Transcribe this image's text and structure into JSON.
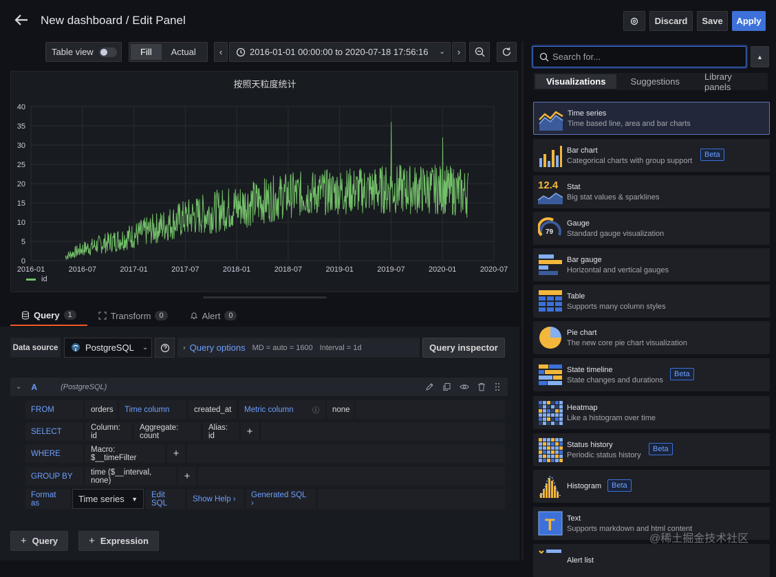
{
  "header": {
    "title": "New dashboard / Edit Panel",
    "discard": "Discard",
    "save": "Save",
    "apply": "Apply"
  },
  "toolbar": {
    "table_view": "Table view",
    "fill": "Fill",
    "actual": "Actual",
    "time_range": "2016-01-01 00:00:00 to 2020-07-18 17:56:16"
  },
  "panel": {
    "title": "按照天粒度统计"
  },
  "chart_data": {
    "type": "line",
    "x_ticks": [
      "2016-01",
      "2016-07",
      "2017-01",
      "2017-07",
      "2018-01",
      "2018-07",
      "2019-01",
      "2019-07",
      "2020-01",
      "2020-07"
    ],
    "y_ticks": [
      "0",
      "5",
      "10",
      "15",
      "20",
      "25",
      "30",
      "35",
      "40"
    ],
    "ylim": [
      0,
      40
    ],
    "series": [
      {
        "name": "id",
        "color": "#73bf69"
      }
    ],
    "trend": [
      {
        "x": "2016-05",
        "low": 0,
        "high": 2
      },
      {
        "x": "2016-07",
        "low": 1,
        "high": 5
      },
      {
        "x": "2017-01",
        "low": 3,
        "high": 10
      },
      {
        "x": "2017-07",
        "low": 6,
        "high": 16
      },
      {
        "x": "2018-01",
        "low": 8,
        "high": 20
      },
      {
        "x": "2018-07",
        "low": 11,
        "high": 23
      },
      {
        "x": "2019-01",
        "low": 12,
        "high": 24
      },
      {
        "x": "2019-07",
        "low": 12,
        "high": 25
      },
      {
        "x": "2020-01",
        "low": 12,
        "high": 25
      },
      {
        "x": "2020-04",
        "low": 11,
        "high": 24
      }
    ],
    "peaks": [
      {
        "x": "2019-07",
        "y": 36
      },
      {
        "x": "2020-01",
        "y": 32
      }
    ]
  },
  "legend": {
    "label": "id"
  },
  "tabs": [
    {
      "label": "Query",
      "count": "1"
    },
    {
      "label": "Transform",
      "count": "0"
    },
    {
      "label": "Alert",
      "count": "0"
    }
  ],
  "datasource": {
    "label": "Data source",
    "value": "PostgreSQL",
    "query_options": "Query options",
    "md": "MD = auto = 1600",
    "interval": "Interval = 1d",
    "inspector": "Query inspector"
  },
  "query": {
    "letter": "A",
    "source": "(PostgreSQL)",
    "from": {
      "kw": "FROM",
      "table": "orders",
      "time_col_label": "Time column",
      "time_col": "created_at",
      "metric_label": "Metric column",
      "metric": "none"
    },
    "select": {
      "kw": "SELECT",
      "column": "Column: id",
      "aggregate": "Aggregate: count",
      "alias": "Alias: id"
    },
    "where": {
      "kw": "WHERE",
      "macro": "Macro: $__timeFilter"
    },
    "group": {
      "kw": "GROUP BY",
      "value": "time ($__interval, none)"
    },
    "format": {
      "kw": "Format as",
      "value": "Time series",
      "edit_sql": "Edit SQL",
      "show_help": "Show Help ›",
      "generated": "Generated SQL ›"
    }
  },
  "bottom": {
    "add_query": "Query",
    "add_expression": "Expression"
  },
  "viz": {
    "search_placeholder": "Search for...",
    "tabs": [
      "Visualizations",
      "Suggestions",
      "Library panels"
    ],
    "items": [
      {
        "name": "Time series",
        "desc": "Time based line, area and bar charts",
        "icon": "timeseries-icon"
      },
      {
        "name": "Bar chart",
        "desc": "Categorical charts with group support",
        "icon": "barchart-icon",
        "beta": "Beta"
      },
      {
        "name": "Stat",
        "desc": "Big stat values & sparklines",
        "icon": "stat-icon"
      },
      {
        "name": "Gauge",
        "desc": "Standard gauge visualization",
        "icon": "gauge-icon"
      },
      {
        "name": "Bar gauge",
        "desc": "Horizontal and vertical gauges",
        "icon": "bargauge-icon"
      },
      {
        "name": "Table",
        "desc": "Supports many column styles",
        "icon": "table-icon"
      },
      {
        "name": "Pie chart",
        "desc": "The new core pie chart visualization",
        "icon": "piechart-icon"
      },
      {
        "name": "State timeline",
        "desc": "State changes and durations",
        "icon": "statetimeline-icon",
        "beta": "Beta"
      },
      {
        "name": "Heatmap",
        "desc": "Like a histogram over time",
        "icon": "heatmap-icon"
      },
      {
        "name": "Status history",
        "desc": "Periodic status history",
        "icon": "statushistory-icon",
        "beta": "Beta"
      },
      {
        "name": "Histogram",
        "desc": "",
        "icon": "histogram-icon",
        "beta": "Beta"
      },
      {
        "name": "Text",
        "desc": "Supports markdown and html content",
        "icon": "text-icon"
      },
      {
        "name": "Alert list",
        "desc": "",
        "icon": "alertlist-icon"
      }
    ],
    "stat_value": "12.4",
    "gauge_value": "79"
  },
  "watermark": "@稀土掘金技术社区"
}
